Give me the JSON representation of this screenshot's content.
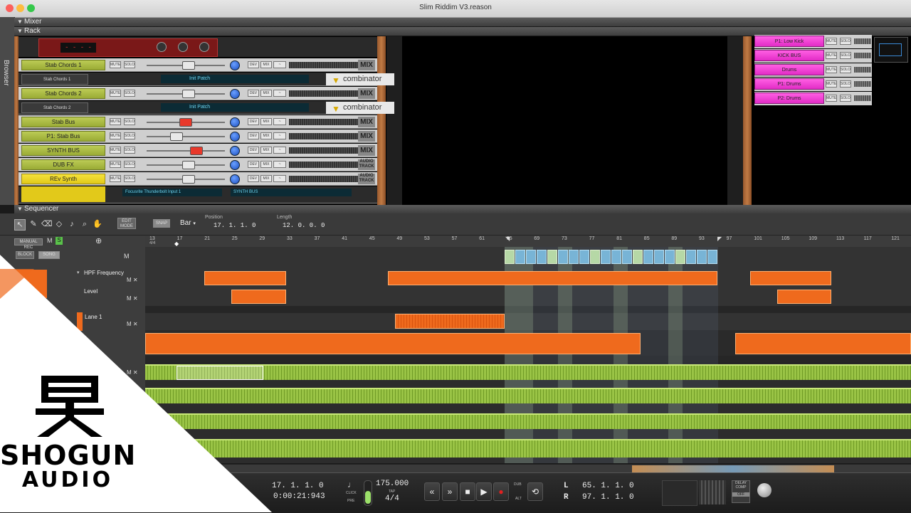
{
  "window": {
    "title": "Slim Riddim V3.reason"
  },
  "sidebar": {
    "browser_label": "Browser"
  },
  "sections": {
    "mixer": "Mixer",
    "rack": "Rack",
    "sequencer": "Sequencer"
  },
  "rack": {
    "channels": [
      {
        "name": "Stab Chords 1",
        "type": "mix",
        "fader_color": "#e8e8e8",
        "fader_pos": 0.45
      },
      {
        "name": "Stab Chords 1",
        "type": "combinator",
        "patch": "Init Patch"
      },
      {
        "name": "Stab Chords 2",
        "type": "mix",
        "fader_color": "#e8e8e8",
        "fader_pos": 0.45
      },
      {
        "name": "Stab Chords 2",
        "type": "combinator",
        "patch": "Init Patch"
      },
      {
        "name": "Stab Bus",
        "type": "mix",
        "fader_color": "#e8382a",
        "fader_pos": 0.42
      },
      {
        "name": "P1: Stab Bus",
        "type": "mix",
        "fader_color": "#e8e8e8",
        "fader_pos": 0.3
      },
      {
        "name": "SYNTH BUS",
        "type": "mix",
        "fader_color": "#e8382a",
        "fader_pos": 0.55
      },
      {
        "name": "DUB FX",
        "type": "audio",
        "fader_color": "#e8e8e8",
        "fader_pos": 0.45
      },
      {
        "name": "REv Synth",
        "type": "audio",
        "fader_color": "#e8e8e8",
        "fader_pos": 0.45
      }
    ],
    "mix_label": "MIX",
    "audio_track_label": "AUDIO TRACK",
    "combinator_label": "combinator",
    "mute": "MUTE",
    "solo": "SOLO",
    "input_label": "Focusrite Thunderbolt Input 1",
    "output_label": "SYNTH BUS"
  },
  "mixer_right": {
    "channels": [
      "P1: Low Kick",
      "KICK BUS",
      "Drums",
      "P1: Drums",
      "P2: Drums"
    ]
  },
  "sequencer": {
    "edit_mode": "EDIT MODE",
    "snap": "SNAP",
    "snap_value": "Bar",
    "position_label": "Position",
    "position_value": "17. 1. 1. 0",
    "length_label": "Length",
    "length_value": "12. 0. 0. 0",
    "manual_rec": "MANUAL REC",
    "block": "BLOCK",
    "song": "SONG",
    "ruler_ticks": [
      "13",
      "17",
      "21",
      "25",
      "29",
      "33",
      "37",
      "41",
      "45",
      "49",
      "53",
      "57",
      "61",
      "65",
      "69",
      "73",
      "77",
      "81",
      "85",
      "89",
      "93",
      "97",
      "101",
      "105",
      "109",
      "113",
      "117",
      "121"
    ],
    "time_signature": "4/4",
    "tracks": [
      {
        "name": "HPF Frequency"
      },
      {
        "name": "Level"
      },
      {
        "name": "Lane 1"
      }
    ]
  },
  "transport": {
    "position_bars": "17. 1. 1. 0",
    "position_time": "0:00:21:943",
    "click": "CLICK",
    "pre": "PRE",
    "tempo": "175.000",
    "tap": "TAP",
    "signature": "4/4",
    "dub": "DUB",
    "alt": "ALT",
    "loop_left_label": "L",
    "loop_left": "65. 1. 1. 0",
    "loop_right_label": "R",
    "loop_right": "97. 1. 1. 0",
    "delay_comp": "DELAY COMP",
    "delay_off": "OFF"
  },
  "logo": {
    "line1": "SHOGUN",
    "line2": "AUDIO"
  }
}
